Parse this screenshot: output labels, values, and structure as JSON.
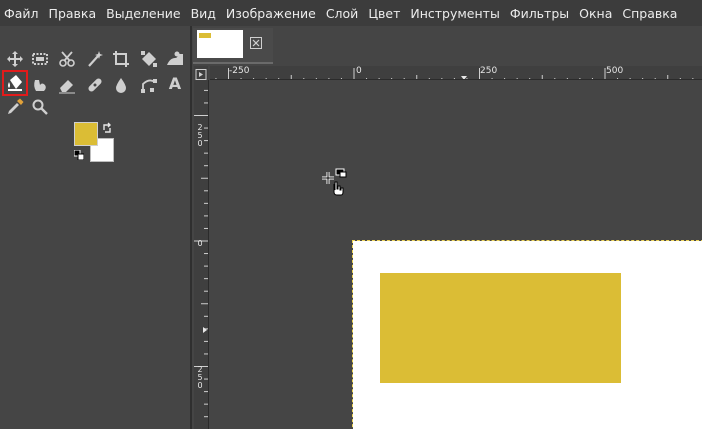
{
  "menubar": {
    "items": [
      "Файл",
      "Правка",
      "Выделение",
      "Вид",
      "Изображение",
      "Слой",
      "Цвет",
      "Инструменты",
      "Фильтры",
      "Окна",
      "Справка"
    ]
  },
  "toolbox": {
    "tools_row1": [
      "move-tool",
      "rect-select-tool",
      "scissors-select-tool",
      "fuzzy-select-tool",
      "crop-tool",
      "unified-transform-tool",
      "warp-transform-tool"
    ],
    "tools_row2": [
      "bucket-fill-tool",
      "smudge-tool",
      "eraser-tool",
      "heal-tool",
      "blur-tool",
      "paths-tool",
      "text-tool"
    ],
    "tools_row3": [
      "color-picker-tool",
      "zoom-tool"
    ],
    "selected_tool": "bucket-fill-tool",
    "text_tool_glyph": "A",
    "foreground_color": "#dbbd35",
    "background_color": "#ffffff"
  },
  "image_tab": {
    "thumb_color": "#dbbd35"
  },
  "rulers": {
    "top_labels": [
      "-250",
      "0",
      "250",
      "500"
    ],
    "left_labels": [
      "250",
      "0",
      "250"
    ]
  },
  "canvas": {
    "fill_color": "#dbbd35",
    "selection_color": "#f0d65a"
  }
}
